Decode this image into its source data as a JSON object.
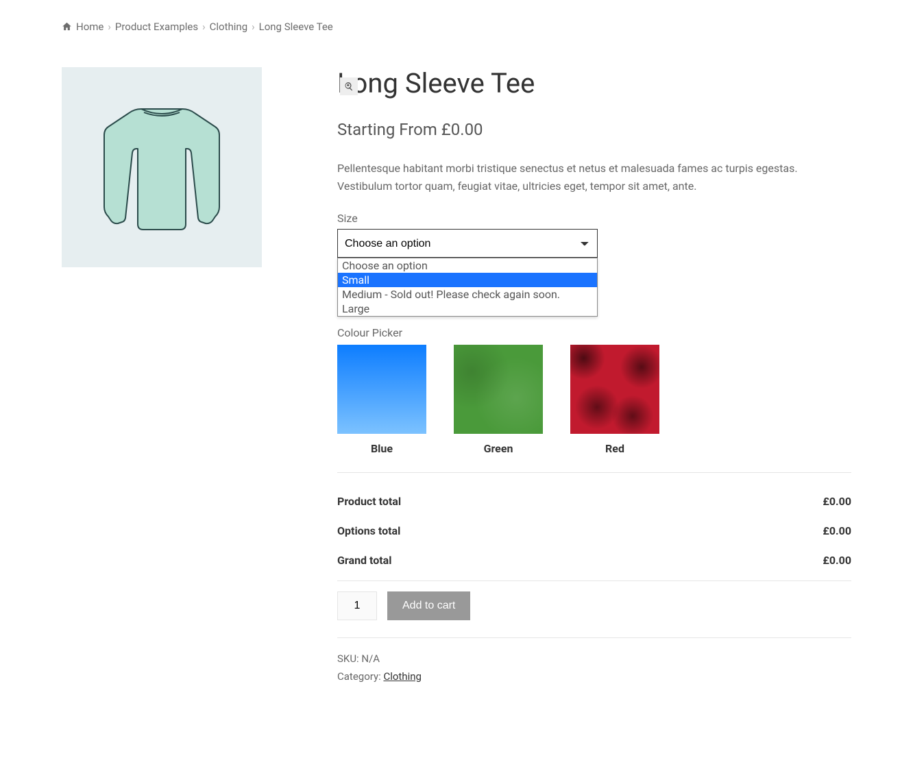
{
  "breadcrumb": {
    "items": [
      {
        "label": "Home"
      },
      {
        "label": "Product Examples"
      },
      {
        "label": "Clothing"
      },
      {
        "label": "Long Sleeve Tee"
      }
    ]
  },
  "product": {
    "title": "Long Sleeve Tee",
    "price_prefix": "Starting From ",
    "price": "£0.00",
    "description": "Pellentesque habitant morbi tristique senectus et netus et malesuada fames ac turpis egestas. Vestibulum tortor quam, feugiat vitae, ultricies eget, tempor sit amet, ante."
  },
  "size": {
    "label": "Size",
    "selected": "Choose an option",
    "options": [
      {
        "label": "Choose an option",
        "highlight": false
      },
      {
        "label": "Small",
        "highlight": true
      },
      {
        "label": "Medium - Sold out! Please check again soon.",
        "highlight": false
      },
      {
        "label": "Large",
        "highlight": false
      }
    ]
  },
  "colour": {
    "label": "Colour Picker",
    "options": [
      {
        "name": "Blue",
        "class": "chip-blue"
      },
      {
        "name": "Green",
        "class": "chip-green"
      },
      {
        "name": "Red",
        "class": "chip-red"
      }
    ]
  },
  "totals": {
    "rows": [
      {
        "label": "Product total",
        "value": "£0.00"
      },
      {
        "label": "Options total",
        "value": "£0.00"
      },
      {
        "label": "Grand total",
        "value": "£0.00"
      }
    ]
  },
  "cart": {
    "qty": "1",
    "button": "Add to cart"
  },
  "meta": {
    "sku_label": "SKU: ",
    "sku_value": "N/A",
    "cat_label": "Category: ",
    "cat_value": "Clothing"
  }
}
